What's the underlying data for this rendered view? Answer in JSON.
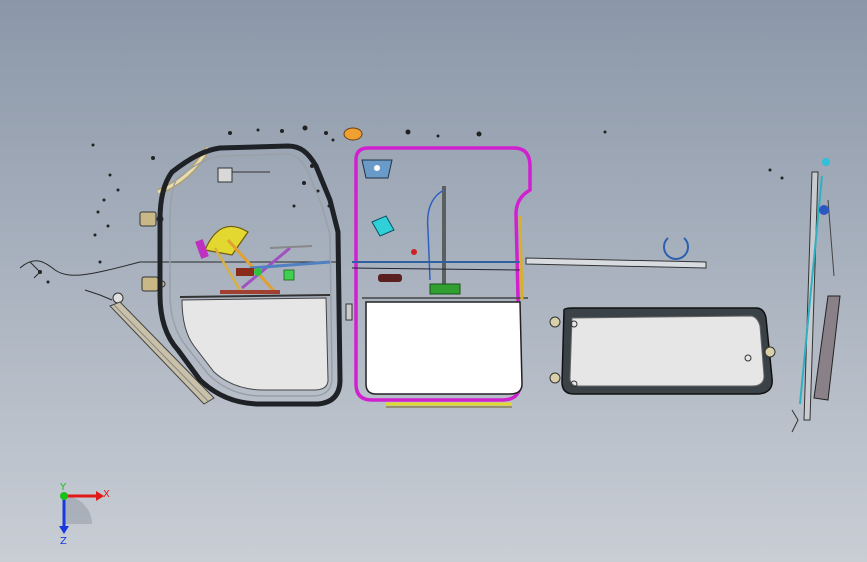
{
  "triad": {
    "x_label": "X",
    "y_label": "Y",
    "z_label": "Z"
  },
  "colors": {
    "background_top": "#8b97a8",
    "background_bottom": "#c9ced5",
    "door_frame": "#1e2226",
    "magenta_frame": "#d020d0",
    "glass": "#e6e6e6",
    "yellow_part": "#e2d830",
    "cyan_part": "#30c0d8",
    "blue_part": "#2a58c0",
    "axis_x": "#e01818",
    "axis_y": "#18c018",
    "axis_z": "#1838e0"
  }
}
